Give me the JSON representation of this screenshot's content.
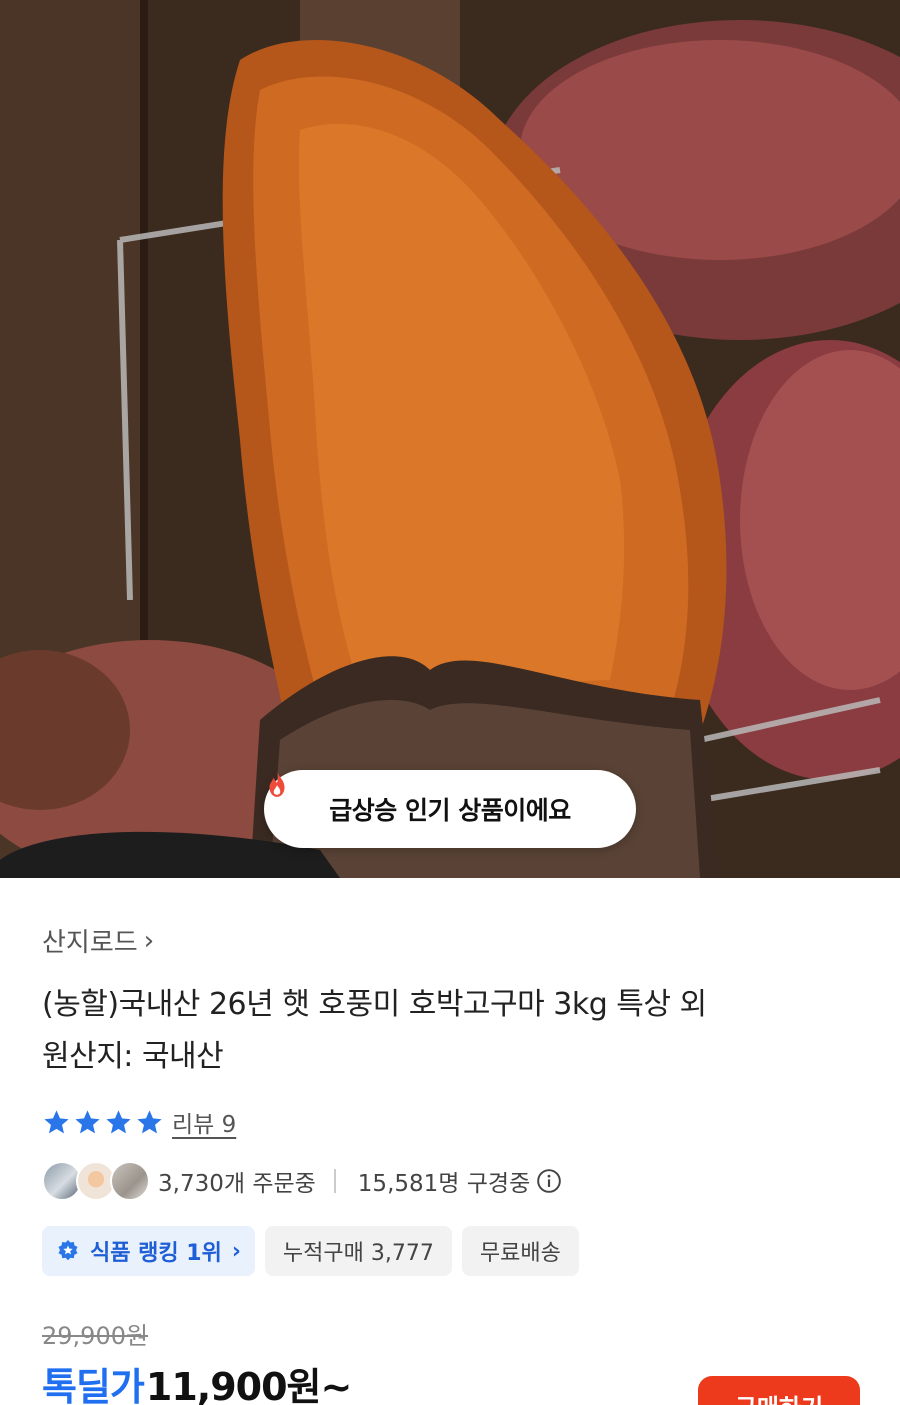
{
  "hero": {
    "badge_text": "급상승 인기 상품이에요",
    "badge_icon": "flame-icon"
  },
  "product": {
    "seller": "산지로드",
    "title": "(농할)국내산 26년 햇 호풍미 호박고구마 3kg 특상 외",
    "origin": "원산지: 국내산",
    "rating_stars": 4,
    "review_label": "리뷰 9",
    "orders": "3,730개 주문중",
    "viewers": "15,581명 구경중",
    "chips": {
      "rank": "식품 랭킹 1위",
      "cumulative": "누적구매 3,777",
      "shipping": "무료배송"
    },
    "original_price": "29,900원",
    "price_label": "톡딜가",
    "price": "11,900원~",
    "buy_label": "구매하기"
  },
  "colors": {
    "accent_blue": "#1f6ff0",
    "star_blue": "#2a76e8",
    "buy_red": "#ee3a1c"
  }
}
